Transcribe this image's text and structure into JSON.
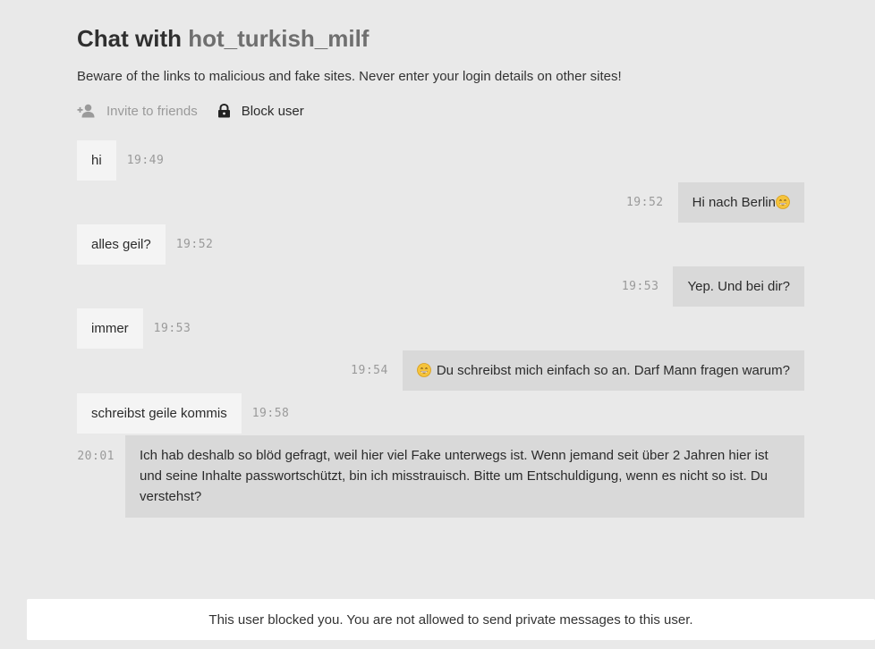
{
  "header": {
    "title_prefix": "Chat with ",
    "username": "hot_turkish_milf",
    "warning": "Beware of the links to malicious and fake sites. Never enter your login details on other sites!",
    "actions": {
      "invite_label": "Invite to friends",
      "invite_icon": "add-user-icon",
      "block_label": "Block user",
      "block_icon": "lock-icon"
    }
  },
  "messages": [
    {
      "side": "received",
      "text": "hi",
      "time": "19:49"
    },
    {
      "side": "sent",
      "text": "Hi nach Berlin",
      "emoji": "grinning-face-emoji",
      "time": "19:52"
    },
    {
      "side": "received",
      "text": "alles geil?",
      "time": "19:52"
    },
    {
      "side": "sent",
      "text": "Yep. Und bei dir?",
      "time": "19:53"
    },
    {
      "side": "received",
      "text": "immer",
      "time": "19:53"
    },
    {
      "side": "sent",
      "text": "Du schreibst mich einfach so an. Darf Mann fragen warum?",
      "emoji": "grinning-face-emoji",
      "time": "19:54"
    },
    {
      "side": "received",
      "text": "schreibst geile kommis",
      "time": "19:58"
    },
    {
      "side": "sent",
      "text": "Ich hab deshalb so blöd gefragt, weil hier viel Fake unterwegs ist. Wenn jemand seit über 2 Jahren hier ist und seine Inhalte passwortschützt, bin ich misstrauisch. Bitte um Entschuldigung, wenn es nicht so ist. Du verstehst?",
      "time": "20:01"
    }
  ],
  "footer": {
    "notice": "This user blocked you. You are not allowed to send private messages to this user."
  },
  "colors": {
    "background": "#e9e9e9",
    "received_bubble": "#f4f4f4",
    "sent_bubble": "#d9d9d9",
    "timestamp": "#9a9a9a",
    "username": "#6f6f6f"
  }
}
